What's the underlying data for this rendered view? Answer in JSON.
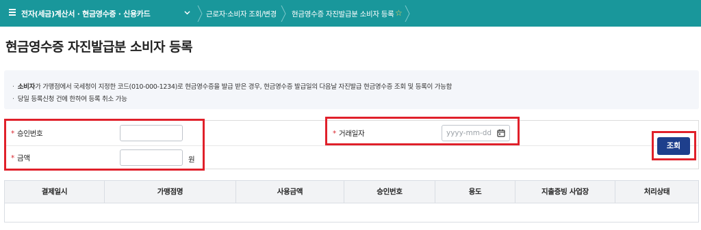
{
  "breadcrumb": {
    "main": "전자(세금)계산서 · 현금영수증 · 신용카드",
    "level2": "근로자·소비자 조회/변경",
    "level3": "현금영수증 자진발급분 소비자 등록"
  },
  "page_title": "현금영수증 자진발급분 소비자 등록",
  "notice": {
    "line1_bold": "소비자",
    "line1_rest": "가 가맹점에서 국세청이 지정한 코드(010-000-1234)로 현금영수증을 발급 받은 경우, 현금영수증 발급일의 다음날 자진발급 현금영수증 조회 및 등록이 가능함",
    "line2": "당일 등록신청 건에 한하여 등록 취소 가능"
  },
  "form": {
    "required_mark": "*",
    "approval_label": "승인번호",
    "approval_value": "",
    "amount_label": "금액",
    "amount_value": "",
    "amount_unit": "원",
    "date_label": "거래일자",
    "date_placeholder": "yyyy-mm-dd",
    "search_label": "조회"
  },
  "table": {
    "columns": [
      "결제일시",
      "가맹점명",
      "사용금액",
      "승인번호",
      "용도",
      "지출증빙 사업장",
      "처리상태"
    ],
    "rows": []
  },
  "colors": {
    "topbar": "#19979b",
    "search_button": "#1e3f8c",
    "highlight": "#e0202a",
    "required": "#d9262e"
  },
  "icons": {
    "menu": "hamburger-icon",
    "chevron": "chevron-down-icon",
    "favorite": "star-icon",
    "calendar": "calendar-icon"
  }
}
